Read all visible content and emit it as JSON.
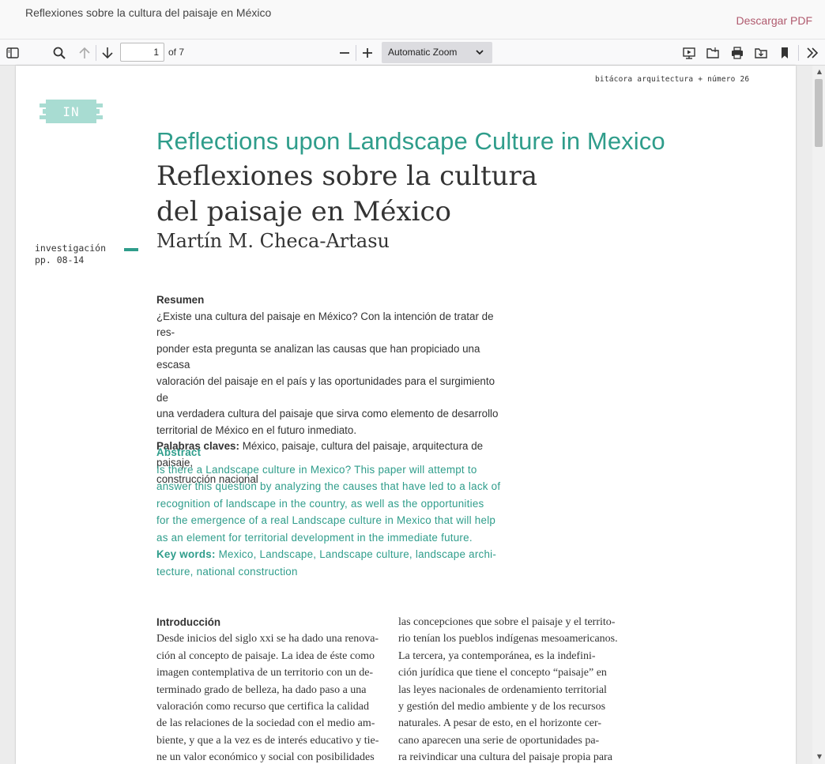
{
  "window": {
    "title": "Reflexiones sobre la cultura del paisaje en México",
    "download_label": "Descargar PDF"
  },
  "toolbar": {
    "page_value": "1",
    "page_total": "of 7",
    "zoom_value": "Automatic Zoom",
    "icons": [
      "sidebar-toggle-icon",
      "search-icon",
      "previous-page-icon",
      "next-page-icon",
      "zoom-out-icon",
      "zoom-in-icon",
      "presentation-icon",
      "open-file-icon",
      "print-icon",
      "download-icon",
      "bookmark-icon",
      "tools-icon"
    ]
  },
  "page": {
    "header": "bitácora arquitectura + número 26",
    "badge": "IN",
    "title_en": "Reflections upon Landscape Culture in Mexico",
    "title_es_line1": "Reflexiones sobre la cultura",
    "title_es_line2": "del paisaje en México",
    "author": "Martín M. Checa-Artasu",
    "section_label_line1": "investigación",
    "section_label_line2": "pp. 08-14",
    "resumen_heading": "Resumen",
    "resumen_lines": [
      "¿Existe una cultura del paisaje en México? Con la intención de tratar de res-",
      "ponder esta pregunta se analizan las causas que han propiciado una escasa",
      "valoración del paisaje en el país y las oportunidades para el surgimiento de",
      "una verdadera cultura del paisaje que sirva como elemento de desarrollo",
      "territorial de México en el futuro inmediato."
    ],
    "palabras_label": "Palabras claves:",
    "palabras_text": " México, paisaje, cultura del paisaje, arquitectura de paisaje,",
    "palabras_text2": "construcción nacional",
    "abstract_heading": "Abstract",
    "abstract_lines": [
      "Is there a Landscape culture in Mexico? This paper will attempt to",
      "answer this question by analyzing the causes that have led to a lack of",
      "recognition of landscape in the country, as well as the opportunities",
      "for the emergence of a real Landscape culture in Mexico that will help",
      "as an element for territorial development in the immediate future."
    ],
    "keywords_label": "Key words:",
    "keywords_text": " Mexico, Landscape, Landscape culture, landscape archi-",
    "keywords_text2": "tecture, national construction",
    "intro_heading": "Introducción",
    "col1_lines": [
      "Desde inicios del siglo xxi se ha dado una renova-",
      "ción al concepto de paisaje. La idea de éste  como",
      "imagen contemplativa de un territorio con un de-",
      "terminado grado de belleza, ha dado paso a una",
      "valoración como recurso que certifica la calidad",
      "de las relaciones de la sociedad con el medio am-",
      "biente, y que a la vez es de interés educativo y tie-",
      "ne un valor económico y social con posibilidades"
    ],
    "col2_lines": [
      "las concepciones que sobre el paisaje y el territo-",
      "rio tenían los pueblos indígenas mesoamericanos.",
      "La tercera, ya contemporánea, es la indefini-",
      "ción jurídica que tiene el concepto “paisaje” en",
      "las leyes nacionales de ordenamiento territorial",
      "y gestión del medio ambiente y de los recursos",
      "naturales. A pesar de esto, en el horizonte cer-",
      "cano aparecen una serie de oportunidades pa-",
      "ra reivindicar una cultura del paisaje propia para"
    ]
  },
  "colors": {
    "accent": "#2f9d8b",
    "badge": "#a8dcd2",
    "download_link": "#b05a6e"
  }
}
